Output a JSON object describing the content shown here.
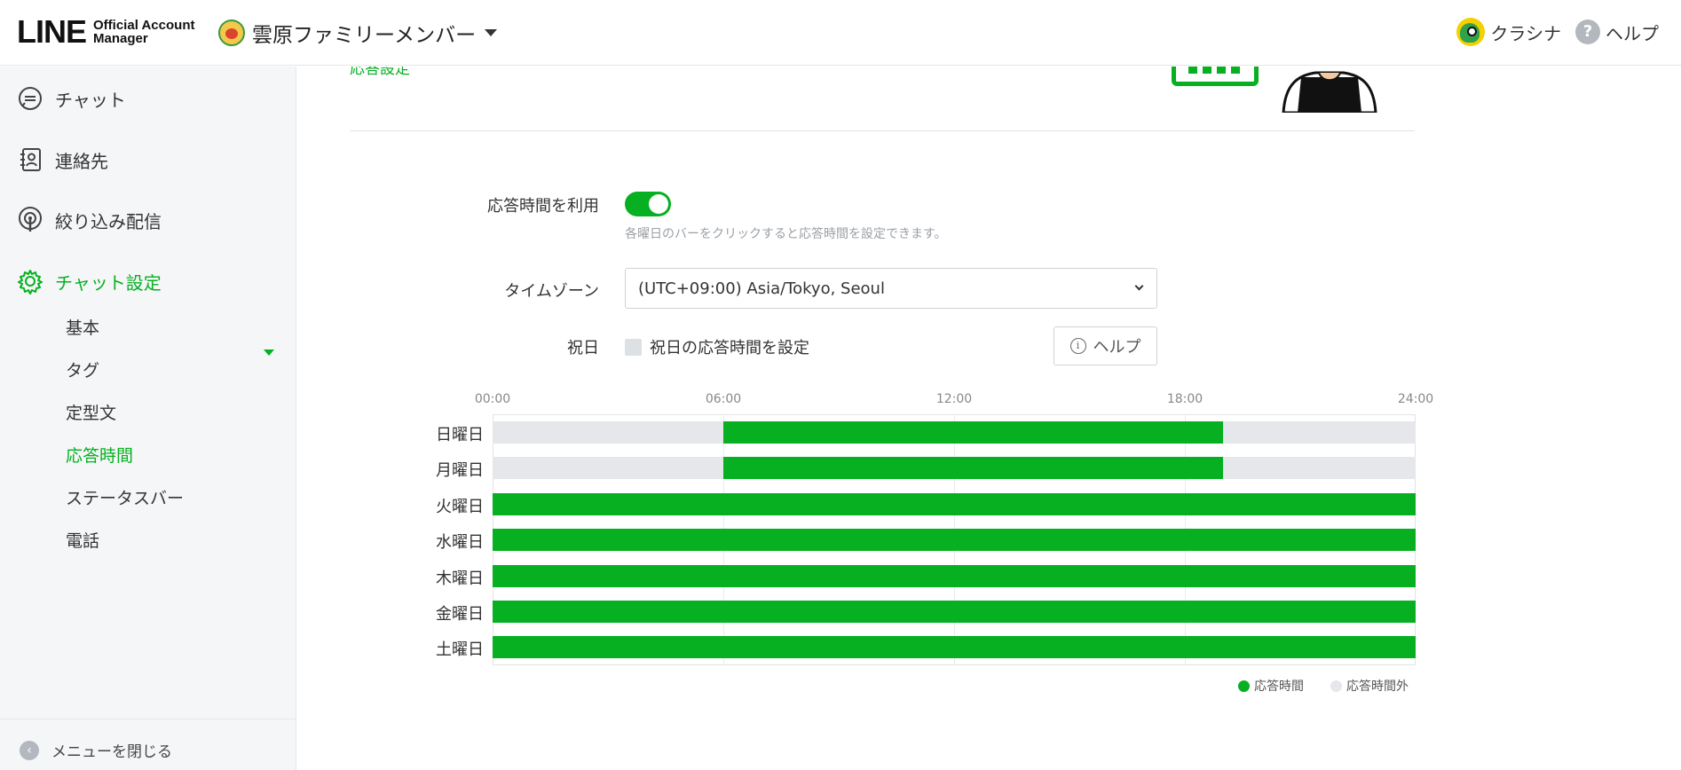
{
  "header": {
    "logo_main": "LINE",
    "logo_sub_line1": "Official Account",
    "logo_sub_line2": "Manager",
    "account_name": "雲原ファミリーメンバー",
    "user_name": "クラシナ",
    "help_label": "ヘルプ"
  },
  "sidebar": {
    "items": [
      {
        "label": "チャット",
        "icon": "chat-bubble-icon"
      },
      {
        "label": "連絡先",
        "icon": "contact-book-icon"
      },
      {
        "label": "絞り込み配信",
        "icon": "broadcast-icon"
      },
      {
        "label": "チャット設定",
        "icon": "gear-icon",
        "active": true
      }
    ],
    "sub_items": [
      {
        "label": "基本"
      },
      {
        "label": "タグ"
      },
      {
        "label": "定型文"
      },
      {
        "label": "応答時間",
        "active": true
      },
      {
        "label": "ステータスバー"
      },
      {
        "label": "電話"
      }
    ],
    "close_menu_label": "メニューを閉じる"
  },
  "main": {
    "top_link_partial": "応答設定",
    "response_time_label": "応答時間を利用",
    "response_time_enabled": true,
    "hint": "各曜日のバーをクリックすると応答時間を設定できます。",
    "timezone_label": "タイムゾーン",
    "timezone_value": "(UTC+09:00) Asia/Tokyo, Seoul",
    "holiday_label": "祝日",
    "holiday_checkbox_label": "祝日の応答時間を設定",
    "holiday_checked": false,
    "help_button_label": "ヘルプ"
  },
  "colors": {
    "accent": "#06b021",
    "off_hours": "#e5e7ea"
  },
  "chart_data": {
    "type": "bar",
    "orientation": "horizontal-range",
    "x_ticks": [
      "00:00",
      "06:00",
      "12:00",
      "18:00",
      "24:00"
    ],
    "xlim": [
      0,
      24
    ],
    "categories": [
      "日曜日",
      "月曜日",
      "火曜日",
      "水曜日",
      "木曜日",
      "金曜日",
      "土曜日"
    ],
    "series": [
      {
        "name": "応答時間",
        "ranges": [
          [
            6,
            19
          ],
          [
            6,
            19
          ],
          [
            0,
            24
          ],
          [
            0,
            24
          ],
          [
            0,
            24
          ],
          [
            0,
            24
          ],
          [
            0,
            24
          ]
        ]
      }
    ],
    "legend": [
      {
        "label": "応答時間",
        "color": "#06b021"
      },
      {
        "label": "応答時間外",
        "color": "#e5e7ea"
      }
    ],
    "legend_position": "bottom-right",
    "grid": true
  }
}
